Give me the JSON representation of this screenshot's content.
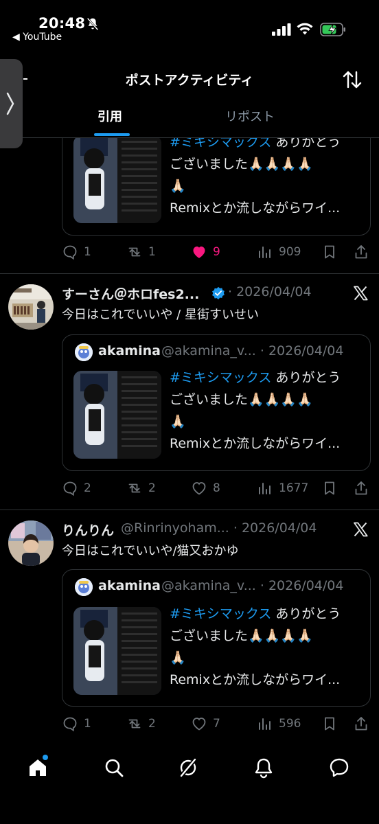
{
  "status_bar": {
    "time": "20:48",
    "back_app": "◀ YouTube"
  },
  "header": {
    "title": "ポストアクティビティ",
    "tabs": [
      {
        "label": "引用",
        "active": true
      },
      {
        "label": "リポスト",
        "active": false
      }
    ]
  },
  "quoted": {
    "name": "akamina",
    "handle": "@akamina_v...",
    "date": "· 2026/04/04",
    "line1_hashtag": "#ミキシマックス",
    "line1_rest": " ありがとう",
    "line2": "ございました🙏🏻🙏🏻🙏🏻🙏🏻",
    "line3": "🙏🏻",
    "line4": "Remixとか流しながらワイ..."
  },
  "posts": [
    {
      "replies": "1",
      "reposts": "1",
      "likes": "9",
      "liked": true,
      "views": "909"
    },
    {
      "name": "すーさん＠ホロfes2...",
      "handle": "· 2026/04/04",
      "verified": true,
      "text": "今日はこれでいいや / 星街すいせい",
      "replies": "2",
      "reposts": "2",
      "likes": "8",
      "views": "1677"
    },
    {
      "name": "りんりん",
      "handle": "@Rinrinyoham... · 2026/04/04",
      "text": "今日はこれでいいや/猫又おかゆ",
      "replies": "1",
      "reposts": "2",
      "likes": "7",
      "views": "596"
    }
  ],
  "colors": {
    "accent": "#1d9bf0",
    "like": "#f91880",
    "muted": "#71767b",
    "border": "#2f3336"
  },
  "nav_icons": [
    "home-icon",
    "search-icon",
    "grok-icon",
    "notifications-icon",
    "messages-icon"
  ]
}
